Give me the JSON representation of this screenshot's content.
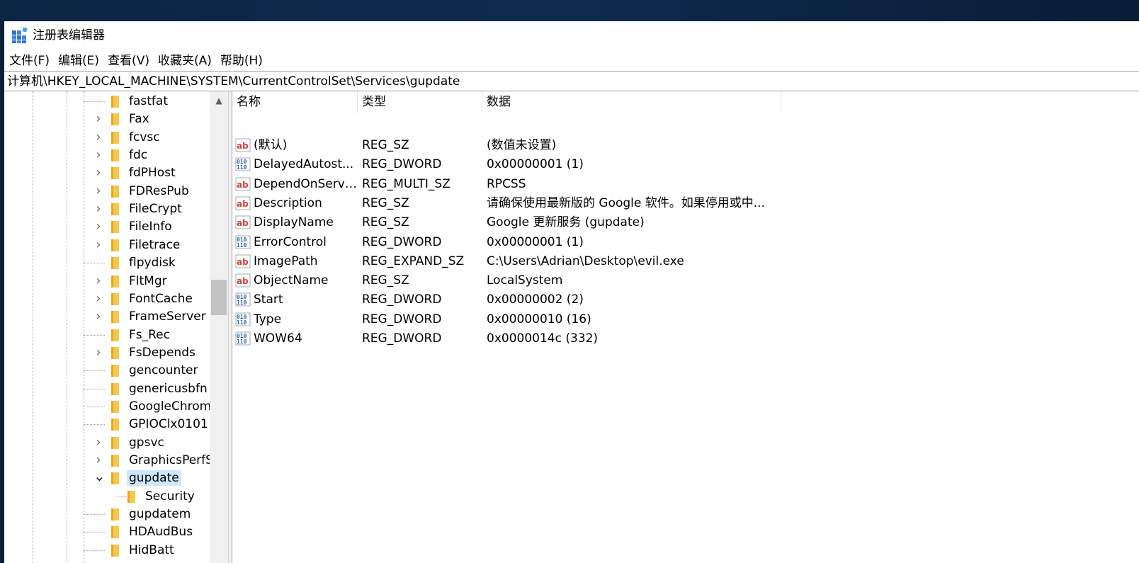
{
  "window": {
    "title": "注册表编辑器"
  },
  "menu": [
    "文件(F)",
    "编辑(E)",
    "查看(V)",
    "收藏夹(A)",
    "帮助(H)"
  ],
  "address": "计算机\\HKEY_LOCAL_MACHINE\\SYSTEM\\CurrentControlSet\\Services\\gupdate",
  "tree": [
    {
      "label": "fastfat",
      "expandable": false
    },
    {
      "label": "Fax",
      "expandable": true
    },
    {
      "label": "fcvsc",
      "expandable": true
    },
    {
      "label": "fdc",
      "expandable": true
    },
    {
      "label": "fdPHost",
      "expandable": true
    },
    {
      "label": "FDResPub",
      "expandable": true
    },
    {
      "label": "FileCrypt",
      "expandable": true
    },
    {
      "label": "FileInfo",
      "expandable": true
    },
    {
      "label": "Filetrace",
      "expandable": true
    },
    {
      "label": "flpydisk",
      "expandable": false
    },
    {
      "label": "FltMgr",
      "expandable": true
    },
    {
      "label": "FontCache",
      "expandable": true
    },
    {
      "label": "FrameServer",
      "expandable": true
    },
    {
      "label": "Fs_Rec",
      "expandable": false
    },
    {
      "label": "FsDepends",
      "expandable": true
    },
    {
      "label": "gencounter",
      "expandable": false
    },
    {
      "label": "genericusbfn",
      "expandable": false
    },
    {
      "label": "GoogleChrom",
      "expandable": false
    },
    {
      "label": "GPIOClx0101",
      "expandable": false
    },
    {
      "label": "gpsvc",
      "expandable": true
    },
    {
      "label": "GraphicsPerfS",
      "expandable": true
    },
    {
      "label": "gupdate",
      "expandable": true,
      "expanded": true,
      "selected": true
    },
    {
      "label": "Security",
      "expandable": false,
      "child": true
    },
    {
      "label": "gupdatem",
      "expandable": false
    },
    {
      "label": "HDAudBus",
      "expandable": false
    },
    {
      "label": "HidBatt",
      "expandable": false
    }
  ],
  "columns": {
    "name": "名称",
    "type": "类型",
    "data": "数据"
  },
  "values": [
    {
      "icon": "string-value-icon",
      "name": "(默认)",
      "type": "REG_SZ",
      "data": "(数值未设置)"
    },
    {
      "icon": "dword-value-icon",
      "name": "DelayedAutost...",
      "type": "REG_DWORD",
      "data": "0x00000001 (1)"
    },
    {
      "icon": "string-value-icon",
      "name": "DependOnServi...",
      "type": "REG_MULTI_SZ",
      "data": "RPCSS"
    },
    {
      "icon": "string-value-icon",
      "name": "Description",
      "type": "REG_SZ",
      "data": "请确保使用最新版的 Google 软件。如果停用或中..."
    },
    {
      "icon": "string-value-icon",
      "name": "DisplayName",
      "type": "REG_SZ",
      "data": "Google 更新服务 (gupdate)"
    },
    {
      "icon": "dword-value-icon",
      "name": "ErrorControl",
      "type": "REG_DWORD",
      "data": "0x00000001 (1)"
    },
    {
      "icon": "string-value-icon",
      "name": "ImagePath",
      "type": "REG_EXPAND_SZ",
      "data": "C:\\Users\\Adrian\\Desktop\\evil.exe"
    },
    {
      "icon": "string-value-icon",
      "name": "ObjectName",
      "type": "REG_SZ",
      "data": "LocalSystem"
    },
    {
      "icon": "dword-value-icon",
      "name": "Start",
      "type": "REG_DWORD",
      "data": "0x00000002 (2)"
    },
    {
      "icon": "dword-value-icon",
      "name": "Type",
      "type": "REG_DWORD",
      "data": "0x00000010 (16)"
    },
    {
      "icon": "dword-value-icon",
      "name": "WOW64",
      "type": "REG_DWORD",
      "data": "0x0000014c (332)"
    }
  ],
  "colors": {
    "selection": "#cce8ff",
    "folder": "#f5c84c",
    "string_icon": "#d64141",
    "dword_icon": "#2b5fb4"
  }
}
